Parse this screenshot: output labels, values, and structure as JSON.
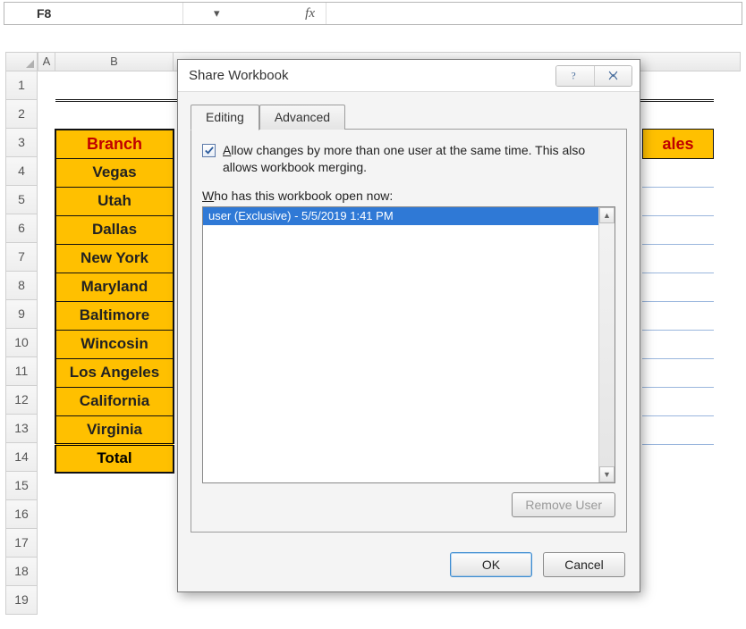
{
  "formula_bar": {
    "name_box": "F8",
    "fx_label": "fx",
    "formula_value": ""
  },
  "columns": [
    "A",
    "B"
  ],
  "rows": [
    "1",
    "2",
    "3",
    "4",
    "5",
    "6",
    "7",
    "8",
    "9",
    "10",
    "11",
    "12",
    "13",
    "14",
    "15",
    "16",
    "17",
    "18",
    "19"
  ],
  "table": {
    "header": "Branch",
    "rows": [
      "Vegas",
      "Utah",
      "Dallas",
      "New York",
      "Maryland",
      "Baltimore",
      "Wincosin",
      "Los Angeles",
      "California",
      "Virginia"
    ],
    "total_label": "Total",
    "sales_header_fragment": "ales"
  },
  "dialog": {
    "title": "Share Workbook",
    "tabs": {
      "editing": "Editing",
      "advanced": "Advanced"
    },
    "allow_changes_pre": "A",
    "allow_changes_main": "llow changes by more than one user at the same time.  This also allows workbook merging.",
    "who_pre": "W",
    "who_rest": "ho has this workbook open now:",
    "user_entry": "user (Exclusive) - 5/5/2019 1:41 PM",
    "buttons": {
      "remove": "Remove User",
      "ok": "OK",
      "cancel": "Cancel"
    }
  }
}
